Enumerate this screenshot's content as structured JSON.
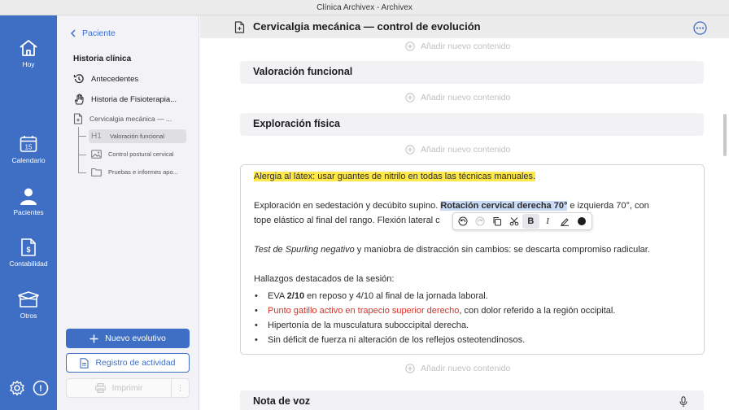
{
  "window": {
    "title": "Clínica Archivex - Archivex"
  },
  "rail": {
    "items": [
      {
        "label": "Hoy",
        "icon": "home-icon"
      },
      {
        "label": "Calendario",
        "icon": "calendar-icon",
        "day": "15"
      },
      {
        "label": "Pacientes",
        "icon": "person-icon"
      },
      {
        "label": "Contabilidad",
        "icon": "invoice-icon"
      },
      {
        "label": "Otros",
        "icon": "box-icon"
      }
    ],
    "bottom": [
      {
        "icon": "gear-icon"
      },
      {
        "icon": "alert-icon",
        "glyph": "!"
      }
    ]
  },
  "sidebar": {
    "back_label": "Paciente",
    "heading": "Historia clínica",
    "items": [
      {
        "label": "Antecedentes",
        "icon": "history-icon"
      },
      {
        "label": "Historia de Fisioterapia...",
        "icon": "hand-icon"
      },
      {
        "label": "Cervicalgia mecánica — ...",
        "icon": "document-icon"
      }
    ],
    "subitems": [
      {
        "label": "Valoración funcional",
        "icon": "heading-icon",
        "glyph": "H1"
      },
      {
        "label": "Control postural cervical",
        "icon": "image-icon"
      },
      {
        "label": "Pruebas e informes apo...",
        "icon": "folder-icon"
      }
    ],
    "new_button": "Nuevo evolutivo",
    "activity_button": "Registro de actividad",
    "print_button": "Imprimir",
    "print_more": "⋮"
  },
  "document": {
    "title": "Cervicalgia mecánica — control de evolución",
    "add_content_label": "Añadir nuevo contenido",
    "sections": {
      "functional": "Valoración funcional",
      "physical": "Exploración física",
      "voice": "Nota de voz"
    },
    "content": {
      "allergy": "Alergia al látex: usar guantes de nitrilo en todas las técnicas manuales.",
      "exploration_a": "Exploración en sedestación y decúbito supino. ",
      "exploration_sel": "Rotación cervical derecha 70°",
      "exploration_b": " e izquierda 70°, con",
      "exploration_line2": "tope elástico al final del rango. Flexión lateral c",
      "spurling_italic": "Test de Spurling negativo",
      "spurling_rest": " y maniobra de distracción sin cambios: se descarta compromiso radicular.",
      "findings_title": "Hallazgos destacados de la sesión:",
      "bullet1_a": "EVA ",
      "bullet1_bold": "2/10",
      "bullet1_b": " en reposo y 4/10 al final de la jornada laboral.",
      "bullet2_red": "Punto gatillo activo en trapecio superior derecho",
      "bullet2_rest": ", con dolor referido a la región occipital.",
      "bullet3": "Hipertonía de la musculatura suboccipital derecha.",
      "bullet4": "Sin déficit de fuerza ni alteración de los reflejos osteotendinosos."
    }
  },
  "format_toolbar": {
    "tools": [
      {
        "name": "undo-icon"
      },
      {
        "name": "redo-icon"
      },
      {
        "name": "copy-icon"
      },
      {
        "name": "scissors-icon"
      },
      {
        "name": "bold-button",
        "glyph": "B"
      },
      {
        "name": "italic-button",
        "glyph": "I"
      },
      {
        "name": "highlight-icon"
      },
      {
        "name": "color-swatch"
      }
    ]
  },
  "colors": {
    "accent": "#3f6fc4",
    "highlight": "#ffe94a",
    "selection": "#c9dbf5",
    "alert_text": "#d93025"
  }
}
